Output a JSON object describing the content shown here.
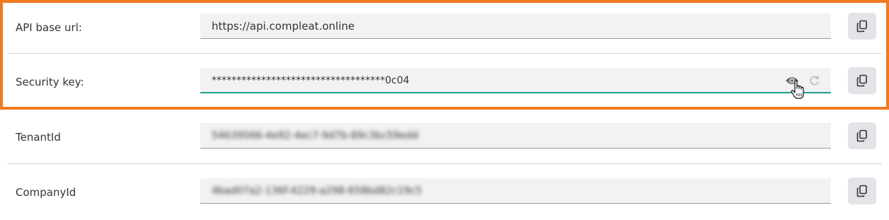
{
  "rows": [
    {
      "label": "API base url:",
      "value": "https://api.compleat.online",
      "blurred": false
    },
    {
      "label": "Security key:",
      "value": "***********************************0c04",
      "blurred": false,
      "active": true
    },
    {
      "label": "TenantId",
      "value": "54639566-4e92-4ec7-9d7b-89c3bc59edd",
      "blurred": true
    },
    {
      "label": "CompanyId",
      "value": "4bad07a2-136f-4229-a298-658bd82c19c5",
      "blurred": true
    }
  ],
  "icons": {
    "copy": "copy-icon",
    "show": "eye-icon",
    "regenerate": "refresh-icon",
    "cursor": "hand-pointer-cursor"
  },
  "colors": {
    "highlight": "#f07a22",
    "active_underline": "#1f9e8e",
    "field_bg": "#f2f2f2",
    "button_bg": "#e3e4e8"
  }
}
